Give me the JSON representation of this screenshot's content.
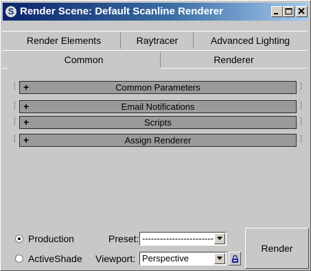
{
  "window": {
    "title": "Render Scene: Default Scanline Renderer",
    "app_icon_glyph": "S"
  },
  "tabs": {
    "row1": [
      {
        "label": "Render Elements"
      },
      {
        "label": "Raytracer"
      },
      {
        "label": "Advanced Lighting"
      }
    ],
    "row2": [
      {
        "label": "Common",
        "selected": true
      },
      {
        "label": "Renderer",
        "selected": false
      }
    ]
  },
  "rollouts": [
    {
      "sign": "+",
      "label": "Common Parameters"
    },
    {
      "sign": "+",
      "label": "Email Notifications"
    },
    {
      "sign": "+",
      "label": "Scripts"
    },
    {
      "sign": "+",
      "label": "Assign Renderer"
    }
  ],
  "bottom": {
    "modes": [
      {
        "label": "Production",
        "selected": true
      },
      {
        "label": "ActiveShade",
        "selected": false
      }
    ],
    "preset_label": "Preset:",
    "preset_value": "--------------------------",
    "viewport_label": "Viewport:",
    "viewport_value": "Perspective",
    "render_label": "Render"
  },
  "icons": [
    "app-icon",
    "minimize-icon",
    "maximize-icon",
    "close-icon",
    "dropdown-arrow-icon",
    "lock-icon"
  ]
}
